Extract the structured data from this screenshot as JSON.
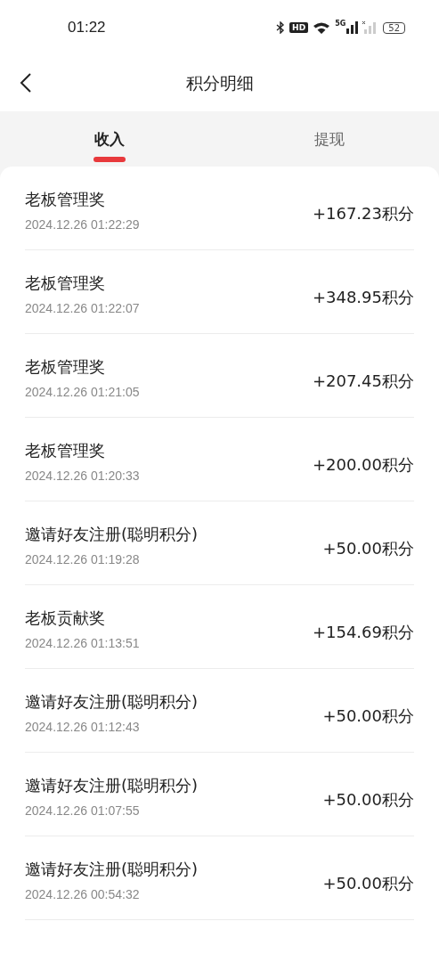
{
  "status_bar": {
    "time": "01:22",
    "hd_label": "HD",
    "network_label": "5G",
    "battery": "52"
  },
  "header": {
    "title": "积分明细"
  },
  "tabs": [
    {
      "label": "收入",
      "selected": true
    },
    {
      "label": "提现",
      "selected": false
    }
  ],
  "records": [
    {
      "title": "老板管理奖",
      "time": "2024.12.26 01:22:29",
      "amount": "+167.23积分"
    },
    {
      "title": "老板管理奖",
      "time": "2024.12.26 01:22:07",
      "amount": "+348.95积分"
    },
    {
      "title": "老板管理奖",
      "time": "2024.12.26 01:21:05",
      "amount": "+207.45积分"
    },
    {
      "title": "老板管理奖",
      "time": "2024.12.26 01:20:33",
      "amount": "+200.00积分"
    },
    {
      "title": "邀请好友注册(聪明积分)",
      "time": "2024.12.26 01:19:28",
      "amount": "+50.00积分"
    },
    {
      "title": "老板贡献奖",
      "time": "2024.12.26 01:13:51",
      "amount": "+154.69积分"
    },
    {
      "title": "邀请好友注册(聪明积分)",
      "time": "2024.12.26 01:12:43",
      "amount": "+50.00积分"
    },
    {
      "title": "邀请好友注册(聪明积分)",
      "time": "2024.12.26 01:07:55",
      "amount": "+50.00积分"
    },
    {
      "title": "邀请好友注册(聪明积分)",
      "time": "2024.12.26 00:54:32",
      "amount": "+50.00积分"
    }
  ]
}
